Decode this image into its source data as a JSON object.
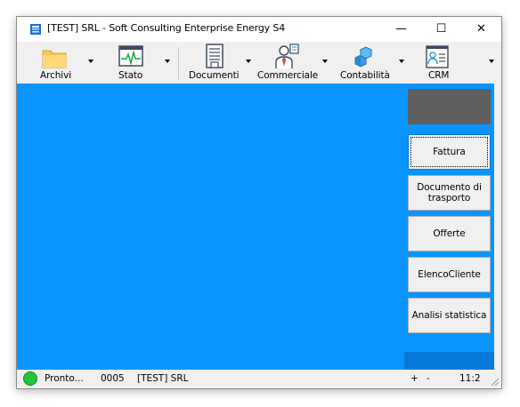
{
  "window": {
    "title": "[TEST] SRL - Soft Consulting Enterprise Energy S4",
    "minimize_glyph": "—",
    "maximize_glyph": "☐",
    "close_glyph": "✕"
  },
  "toolbar": {
    "items": [
      {
        "label": "Archivi",
        "icon": "folder-icon"
      },
      {
        "label": "Stato",
        "icon": "pulse-monitor-icon"
      },
      {
        "label": "Documenti",
        "icon": "document-icon"
      },
      {
        "label": "Commerciale",
        "icon": "salesperson-icon"
      },
      {
        "label": "Contabilità",
        "icon": "cubes-icon"
      },
      {
        "label": "CRM",
        "icon": "contact-card-icon"
      }
    ]
  },
  "side_panel": {
    "buttons": [
      {
        "label": "Fattura"
      },
      {
        "label": "Documento di trasporto"
      },
      {
        "label": "Offerte"
      },
      {
        "label": "ElencoCliente"
      },
      {
        "label": "Analisi statistica"
      }
    ]
  },
  "status": {
    "state": "Pronto...",
    "code": "0005",
    "company": "[TEST] SRL",
    "zoom_plus": "+",
    "zoom_minus": "-",
    "time": "11:2"
  },
  "colors": {
    "main_blue": "#0a94ff",
    "panel_dark_blue": "#0779d9",
    "status_green": "#21c43a",
    "gray_box": "#5f5f5f"
  }
}
